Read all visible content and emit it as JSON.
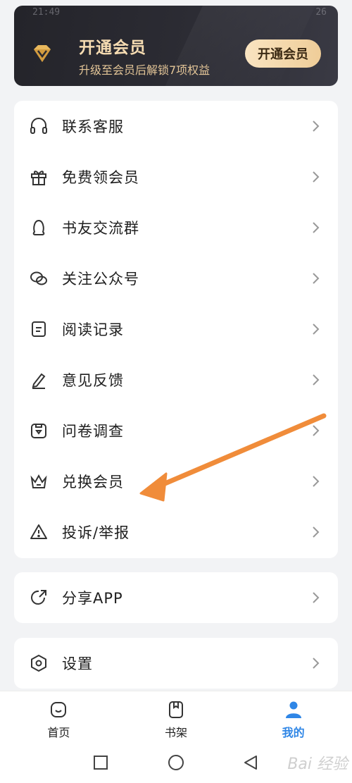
{
  "status_bar": {
    "time": "21:49",
    "battery": "26"
  },
  "vip": {
    "title": "开通会员",
    "subtitle": "升级至会员后解锁7项权益",
    "button_label": "开通会员",
    "gold": "#f4dcb4"
  },
  "menu": {
    "items": [
      {
        "label": "联系客服",
        "icon": "headphones-icon"
      },
      {
        "label": "免费领会员",
        "icon": "gift-icon"
      },
      {
        "label": "书友交流群",
        "icon": "qq-penguin-icon"
      },
      {
        "label": "关注公众号",
        "icon": "wechat-icon"
      },
      {
        "label": "阅读记录",
        "icon": "document-icon"
      },
      {
        "label": "意见反馈",
        "icon": "pen-icon"
      },
      {
        "label": "问卷调查",
        "icon": "survey-icon"
      },
      {
        "label": "兑换会员",
        "icon": "crown-icon"
      },
      {
        "label": "投诉/举报",
        "icon": "warning-icon"
      }
    ]
  },
  "share": {
    "label": "分享APP",
    "icon": "share-icon"
  },
  "settings": {
    "label": "设置",
    "icon": "settings-icon"
  },
  "tabs": [
    {
      "label": "首页",
      "icon": "home-icon",
      "active": false
    },
    {
      "label": "书架",
      "icon": "bookshelf-icon",
      "active": false
    },
    {
      "label": "我的",
      "icon": "profile-icon",
      "active": true
    }
  ],
  "colors": {
    "accent": "#2f86e6",
    "annotation_arrow": "#f08c3a"
  },
  "watermark": "Bai 经验"
}
